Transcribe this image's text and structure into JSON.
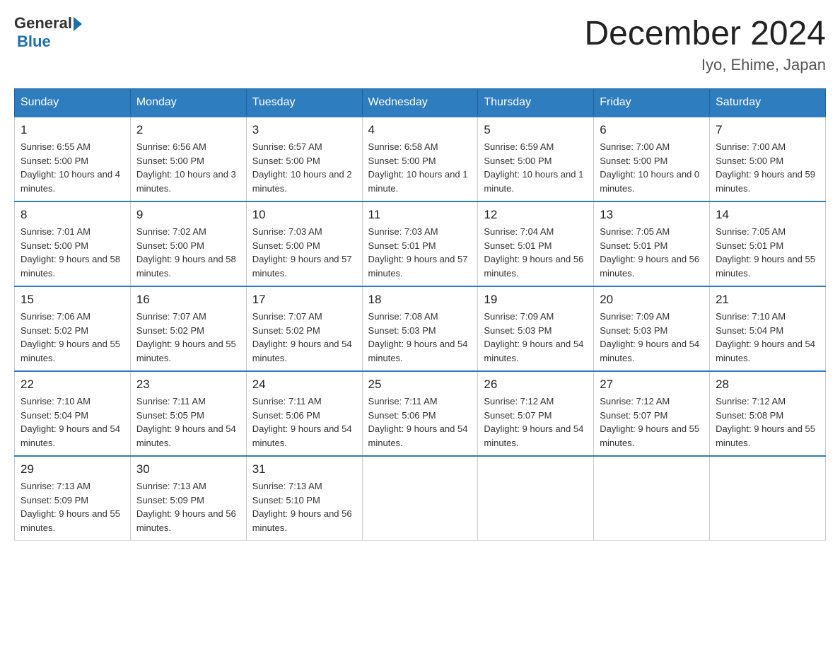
{
  "header": {
    "logo_general": "General",
    "logo_arrow": "▶",
    "logo_blue": "Blue",
    "title": "December 2024",
    "subtitle": "Iyo, Ehime, Japan"
  },
  "weekdays": [
    "Sunday",
    "Monday",
    "Tuesday",
    "Wednesday",
    "Thursday",
    "Friday",
    "Saturday"
  ],
  "weeks": [
    [
      {
        "day": "1",
        "sunrise": "6:55 AM",
        "sunset": "5:00 PM",
        "daylight": "10 hours and 4 minutes."
      },
      {
        "day": "2",
        "sunrise": "6:56 AM",
        "sunset": "5:00 PM",
        "daylight": "10 hours and 3 minutes."
      },
      {
        "day": "3",
        "sunrise": "6:57 AM",
        "sunset": "5:00 PM",
        "daylight": "10 hours and 2 minutes."
      },
      {
        "day": "4",
        "sunrise": "6:58 AM",
        "sunset": "5:00 PM",
        "daylight": "10 hours and 1 minute."
      },
      {
        "day": "5",
        "sunrise": "6:59 AM",
        "sunset": "5:00 PM",
        "daylight": "10 hours and 1 minute."
      },
      {
        "day": "6",
        "sunrise": "7:00 AM",
        "sunset": "5:00 PM",
        "daylight": "10 hours and 0 minutes."
      },
      {
        "day": "7",
        "sunrise": "7:00 AM",
        "sunset": "5:00 PM",
        "daylight": "9 hours and 59 minutes."
      }
    ],
    [
      {
        "day": "8",
        "sunrise": "7:01 AM",
        "sunset": "5:00 PM",
        "daylight": "9 hours and 58 minutes."
      },
      {
        "day": "9",
        "sunrise": "7:02 AM",
        "sunset": "5:00 PM",
        "daylight": "9 hours and 58 minutes."
      },
      {
        "day": "10",
        "sunrise": "7:03 AM",
        "sunset": "5:00 PM",
        "daylight": "9 hours and 57 minutes."
      },
      {
        "day": "11",
        "sunrise": "7:03 AM",
        "sunset": "5:01 PM",
        "daylight": "9 hours and 57 minutes."
      },
      {
        "day": "12",
        "sunrise": "7:04 AM",
        "sunset": "5:01 PM",
        "daylight": "9 hours and 56 minutes."
      },
      {
        "day": "13",
        "sunrise": "7:05 AM",
        "sunset": "5:01 PM",
        "daylight": "9 hours and 56 minutes."
      },
      {
        "day": "14",
        "sunrise": "7:05 AM",
        "sunset": "5:01 PM",
        "daylight": "9 hours and 55 minutes."
      }
    ],
    [
      {
        "day": "15",
        "sunrise": "7:06 AM",
        "sunset": "5:02 PM",
        "daylight": "9 hours and 55 minutes."
      },
      {
        "day": "16",
        "sunrise": "7:07 AM",
        "sunset": "5:02 PM",
        "daylight": "9 hours and 55 minutes."
      },
      {
        "day": "17",
        "sunrise": "7:07 AM",
        "sunset": "5:02 PM",
        "daylight": "9 hours and 54 minutes."
      },
      {
        "day": "18",
        "sunrise": "7:08 AM",
        "sunset": "5:03 PM",
        "daylight": "9 hours and 54 minutes."
      },
      {
        "day": "19",
        "sunrise": "7:09 AM",
        "sunset": "5:03 PM",
        "daylight": "9 hours and 54 minutes."
      },
      {
        "day": "20",
        "sunrise": "7:09 AM",
        "sunset": "5:03 PM",
        "daylight": "9 hours and 54 minutes."
      },
      {
        "day": "21",
        "sunrise": "7:10 AM",
        "sunset": "5:04 PM",
        "daylight": "9 hours and 54 minutes."
      }
    ],
    [
      {
        "day": "22",
        "sunrise": "7:10 AM",
        "sunset": "5:04 PM",
        "daylight": "9 hours and 54 minutes."
      },
      {
        "day": "23",
        "sunrise": "7:11 AM",
        "sunset": "5:05 PM",
        "daylight": "9 hours and 54 minutes."
      },
      {
        "day": "24",
        "sunrise": "7:11 AM",
        "sunset": "5:06 PM",
        "daylight": "9 hours and 54 minutes."
      },
      {
        "day": "25",
        "sunrise": "7:11 AM",
        "sunset": "5:06 PM",
        "daylight": "9 hours and 54 minutes."
      },
      {
        "day": "26",
        "sunrise": "7:12 AM",
        "sunset": "5:07 PM",
        "daylight": "9 hours and 54 minutes."
      },
      {
        "day": "27",
        "sunrise": "7:12 AM",
        "sunset": "5:07 PM",
        "daylight": "9 hours and 55 minutes."
      },
      {
        "day": "28",
        "sunrise": "7:12 AM",
        "sunset": "5:08 PM",
        "daylight": "9 hours and 55 minutes."
      }
    ],
    [
      {
        "day": "29",
        "sunrise": "7:13 AM",
        "sunset": "5:09 PM",
        "daylight": "9 hours and 55 minutes."
      },
      {
        "day": "30",
        "sunrise": "7:13 AM",
        "sunset": "5:09 PM",
        "daylight": "9 hours and 56 minutes."
      },
      {
        "day": "31",
        "sunrise": "7:13 AM",
        "sunset": "5:10 PM",
        "daylight": "9 hours and 56 minutes."
      },
      null,
      null,
      null,
      null
    ]
  ],
  "labels": {
    "sunrise": "Sunrise:",
    "sunset": "Sunset:",
    "daylight": "Daylight:"
  }
}
